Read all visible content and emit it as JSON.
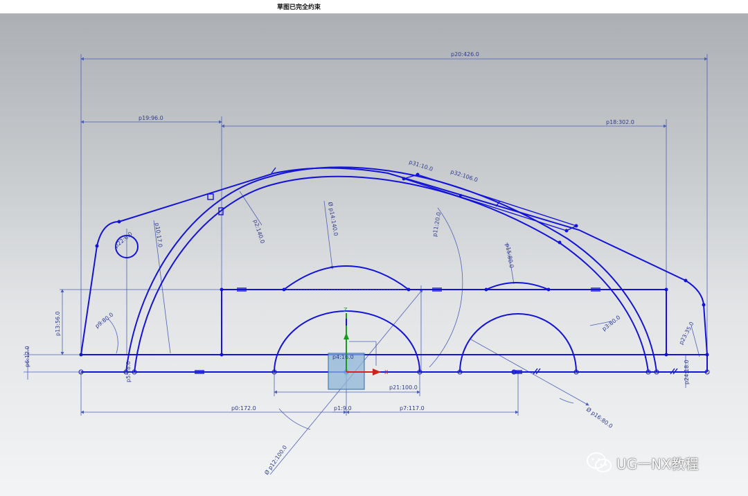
{
  "status_bar": {
    "message": "草图已完全约束"
  },
  "dimensions": {
    "p20": "p20:426.0",
    "p19": "p19:96.0",
    "p18": "p18:302.0",
    "p31": "p31:10.0",
    "p32": "p32:106.0",
    "p14": "Ø p14:140.0",
    "p15": "p15:80.0",
    "p9": "p9:80.0",
    "p10": "p10:17.0",
    "p2": "p2:140.0",
    "p11": "p11:20.0",
    "p3": "p3:80.0",
    "p22": "p22:6.0",
    "p13": "p13:56.0",
    "p6": "p6:12.0",
    "p5": "p5:18.0",
    "p24": "p24:18.0",
    "p23": "p23:35.0",
    "p21": "p21:100.0",
    "p0": "p0:172.0",
    "p1": "p1:9.0",
    "p7": "p7:117.0",
    "p12": "Ø p12:100.0",
    "p16": "Ø p16:80.0",
    "p4": "p4:16.0",
    "p10s": "p10"
  },
  "axes": {
    "x": "X",
    "z": "Z"
  },
  "watermark": {
    "text": "UG一NX教程",
    "icon": "wechat-icon"
  },
  "colors": {
    "sketch": "#1313d6",
    "dimension": "#2f3a8c",
    "x_axis": "#d42020",
    "z_axis": "#1a9a1a"
  }
}
